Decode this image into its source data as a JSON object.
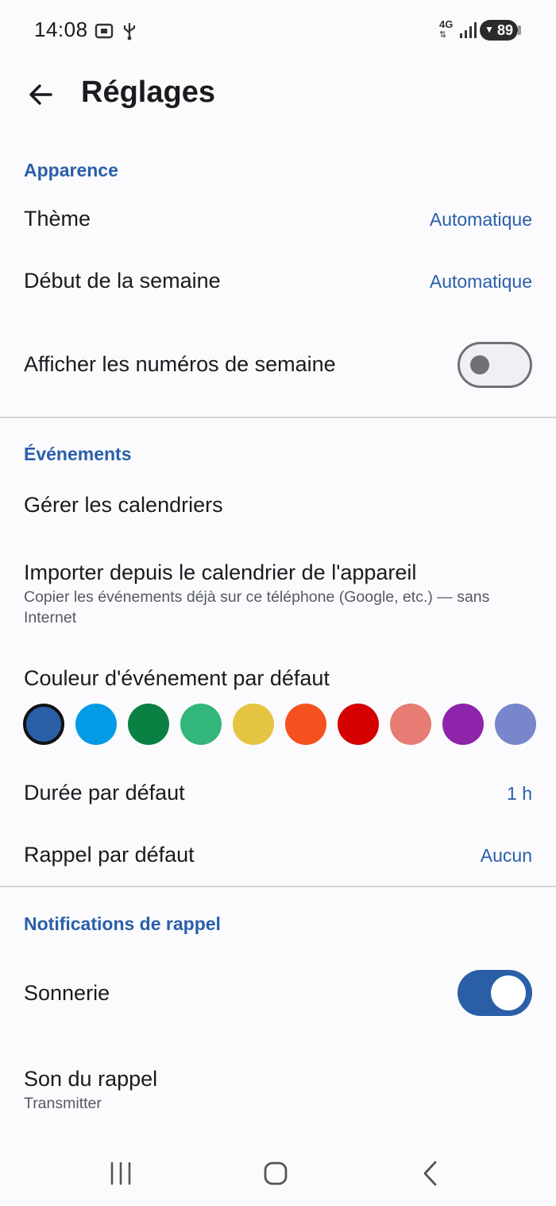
{
  "status_bar": {
    "time": "14:08",
    "network": "4G",
    "battery": "89",
    "icons": [
      "screenshot-icon",
      "usb-icon",
      "network-4g-icon",
      "signal-icon",
      "battery-icon"
    ]
  },
  "app_bar": {
    "title": "Réglages",
    "back_icon": "arrow-back-icon"
  },
  "appearance": {
    "header": "Apparence",
    "theme_label": "Thème",
    "theme_value": "Automatique",
    "week_start_label": "Début de la semaine",
    "week_start_value": "Automatique",
    "week_numbers_label": "Afficher les numéros de semaine",
    "week_numbers_enabled": false
  },
  "events": {
    "header": "Événements",
    "manage_calendars_label": "Gérer les calendriers",
    "import_label": "Importer depuis le calendrier de l'appareil",
    "import_sub": "Copier les événements déjà sur ce téléphone (Google, etc.) — sans Internet",
    "default_color_label": "Couleur d'événement par défaut",
    "colors": [
      "#2a5fa8",
      "#039be5",
      "#0b8043",
      "#33b679",
      "#e4c441",
      "#f4511e",
      "#d50000",
      "#e67c73",
      "#8e24aa",
      "#7986cb"
    ],
    "selected_color_index": 0,
    "default_duration_label": "Durée par défaut",
    "default_duration_value": "1 h",
    "default_reminder_label": "Rappel par défaut",
    "default_reminder_value": "Aucun"
  },
  "notifications": {
    "header": "Notifications de rappel",
    "ringtone_label": "Sonnerie",
    "ringtone_enabled": true,
    "reminder_sound_label": "Son du rappel",
    "reminder_sound_value": "Transmitter"
  },
  "colors": {
    "accent": "#2a5fa8",
    "background": "#fbfbfd",
    "text": "#1b1b1f"
  },
  "nav_bar": {
    "icons": [
      "recents-icon",
      "home-icon",
      "back-icon"
    ]
  }
}
